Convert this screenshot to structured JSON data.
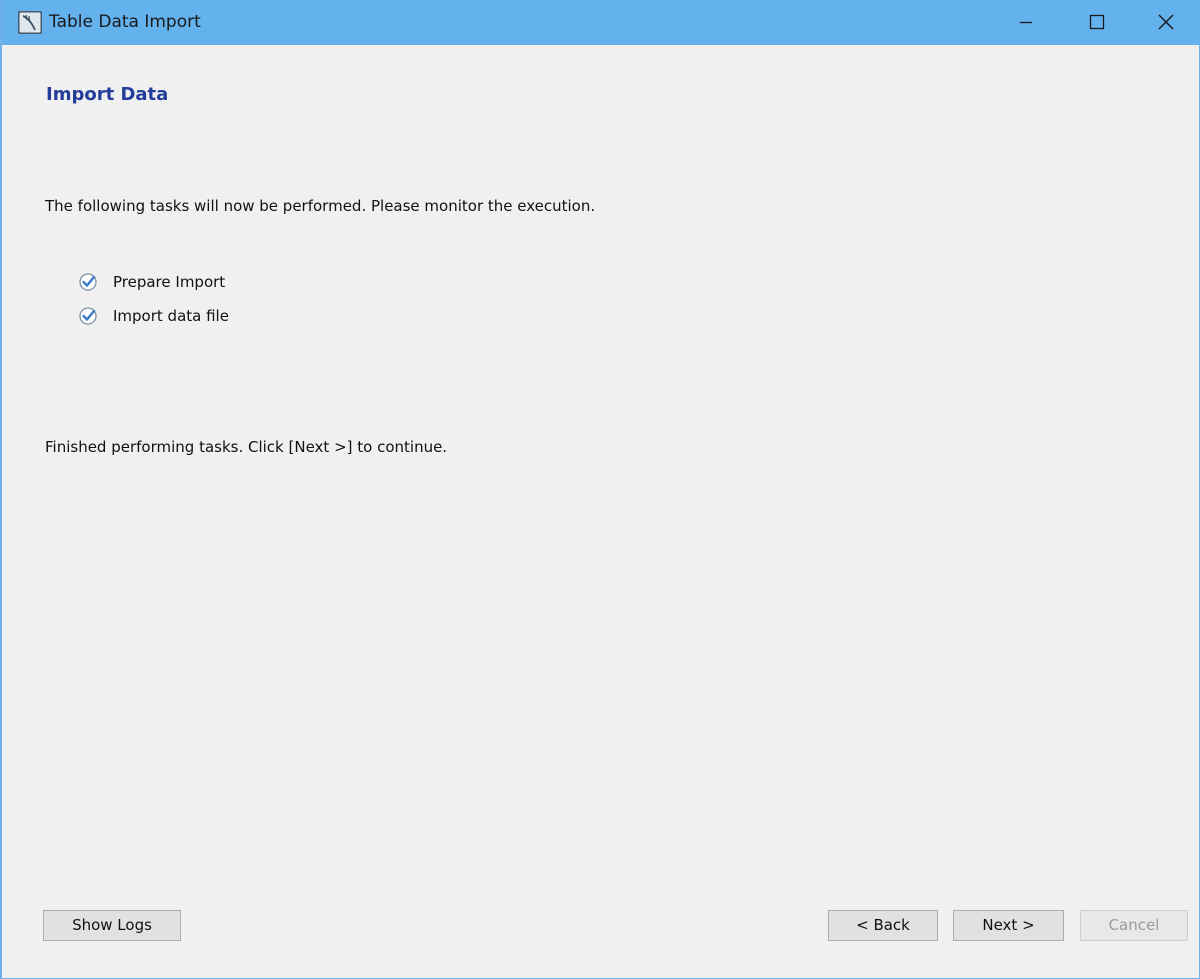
{
  "window": {
    "title": "Table Data Import",
    "icon": "mysql-workbench-dolphin-icon",
    "controls": {
      "minimize": "minimize-icon",
      "maximize": "maximize-icon",
      "close": "close-icon"
    }
  },
  "page": {
    "heading": "Import Data",
    "intro": "The following tasks will now be performed. Please monitor the execution.",
    "tasks": [
      {
        "label": "Prepare Import",
        "status": "completed"
      },
      {
        "label": "Import data file",
        "status": "completed"
      }
    ],
    "finished_message": "Finished performing tasks. Click [Next >] to continue."
  },
  "buttons": {
    "show_logs": "Show Logs",
    "back": "< Back",
    "next": "Next >",
    "cancel": "Cancel"
  },
  "colors": {
    "titlebar": "#63b1ed",
    "heading": "#223c99",
    "check": "#3a78c8"
  }
}
